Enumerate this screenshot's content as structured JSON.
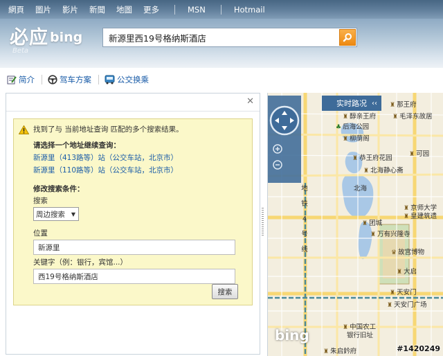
{
  "topnav": {
    "items": [
      "網頁",
      "圖片",
      "影片",
      "新聞",
      "地圖",
      "更多"
    ],
    "extra": [
      "MSN",
      "Hotmail"
    ]
  },
  "logo": {
    "cn": "必应",
    "en": "bing",
    "beta": "Beta"
  },
  "search": {
    "value": "新源里西19号格纳斯酒店"
  },
  "toolbar": {
    "intro": "简介",
    "drive": "驾车方案",
    "transit": "公交换乘"
  },
  "notice": {
    "message": "找到了与 当前地址查询 匹配的多个搜索结果。",
    "choose": "请选择一个地址继续查询：",
    "results": [
      "新源里（413路等）站（公交车站，北京市）",
      "新源里（110路等）站（公交车站，北京市）"
    ],
    "modify": "修改搜索条件：",
    "search_label": "搜索",
    "search_type": "周边搜索",
    "location_label": "位置",
    "location_value": "新源里",
    "keyword_label": "关键字（例：银行，宾馆...）",
    "keyword_value": "西19号格纳斯酒店",
    "search_button": "搜索"
  },
  "map": {
    "traffic": "实时路况",
    "collapse": "‹‹",
    "pois": [
      "那王府",
      "醇亲王府",
      "毛泽东故居",
      "后海公园",
      "柳荫阁",
      "恭王府花园",
      "可园",
      "北海静心斋",
      "京师大学",
      "皇建筑遗",
      "团城",
      "万有兴隆寺",
      "故宫博物",
      "大启",
      "天安门",
      "天安门广场",
      "中国农工",
      "银行旧址",
      "朱启鈐府",
      "北海"
    ],
    "metro": "地铁4号线",
    "bing": "bing",
    "watermark": "#1420249"
  }
}
